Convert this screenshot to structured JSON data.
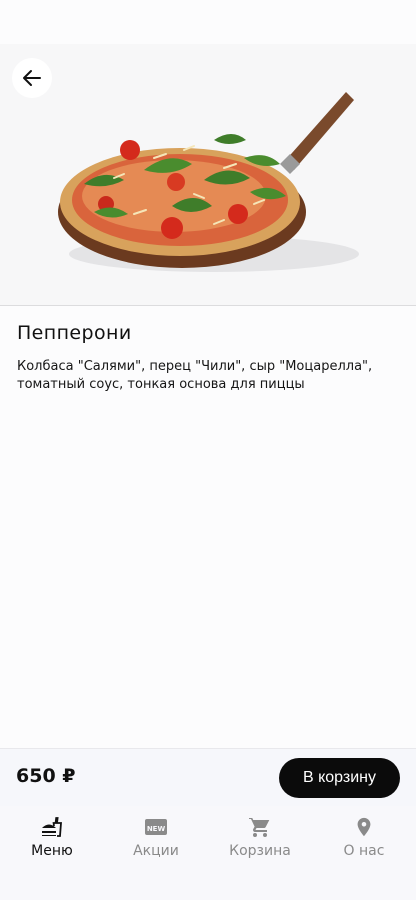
{
  "product": {
    "name": "Пепперони",
    "description": "Колбаса \"Салями\", перец \"Чили\", сыр \"Моцарелла\", томатный соус, тонкая основа для пиццы",
    "price": "650 ₽"
  },
  "actions": {
    "add_to_cart": "В корзину"
  },
  "nav": {
    "items": [
      {
        "label": "Меню",
        "icon": "fastfood-icon",
        "active": true
      },
      {
        "label": "Акции",
        "icon": "new-badge-icon",
        "active": false
      },
      {
        "label": "Корзина",
        "icon": "cart-icon",
        "active": false
      },
      {
        "label": "О нас",
        "icon": "location-pin-icon",
        "active": false
      }
    ]
  },
  "colors": {
    "accent": "#0b0b0b",
    "inactive": "#8a8a8a",
    "background": "#fcfcfd"
  }
}
